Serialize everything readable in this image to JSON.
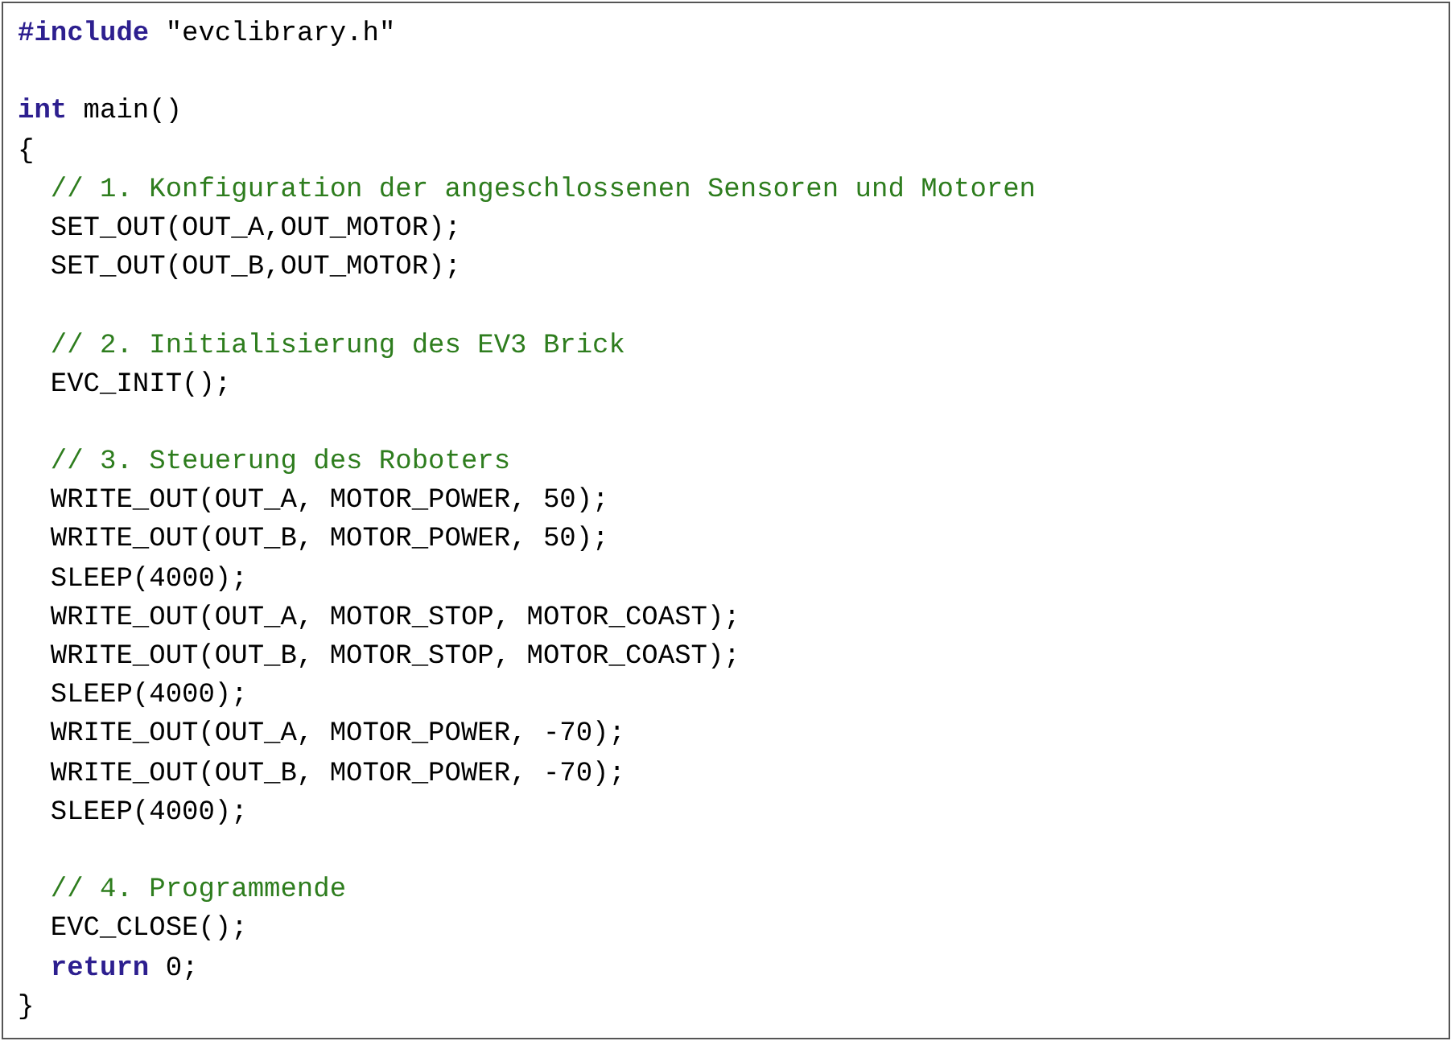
{
  "listing": {
    "lines": [
      {
        "kind": "code",
        "tokens": [
          {
            "kind": "keyword",
            "text": "#include"
          },
          {
            "kind": "plain",
            "text": " \"evclibrary.h\""
          }
        ]
      },
      {
        "kind": "blank"
      },
      {
        "kind": "code",
        "tokens": [
          {
            "kind": "keyword",
            "text": "int"
          },
          {
            "kind": "plain",
            "text": " main()"
          }
        ]
      },
      {
        "kind": "code",
        "tokens": [
          {
            "kind": "plain",
            "text": "{"
          }
        ]
      },
      {
        "kind": "code",
        "tokens": [
          {
            "kind": "comment",
            "text": "  // 1. Konfiguration der angeschlossenen Sensoren und Motoren"
          }
        ]
      },
      {
        "kind": "code",
        "tokens": [
          {
            "kind": "plain",
            "text": "  SET_OUT(OUT_A,OUT_MOTOR);"
          }
        ]
      },
      {
        "kind": "code",
        "tokens": [
          {
            "kind": "plain",
            "text": "  SET_OUT(OUT_B,OUT_MOTOR);"
          }
        ]
      },
      {
        "kind": "blank"
      },
      {
        "kind": "code",
        "tokens": [
          {
            "kind": "comment",
            "text": "  // 2. Initialisierung des EV3 Brick"
          }
        ]
      },
      {
        "kind": "code",
        "tokens": [
          {
            "kind": "plain",
            "text": "  EVC_INIT();"
          }
        ]
      },
      {
        "kind": "blank"
      },
      {
        "kind": "code",
        "tokens": [
          {
            "kind": "comment",
            "text": "  // 3. Steuerung des Roboters"
          }
        ]
      },
      {
        "kind": "code",
        "tokens": [
          {
            "kind": "plain",
            "text": "  WRITE_OUT(OUT_A, MOTOR_POWER, 50);"
          }
        ]
      },
      {
        "kind": "code",
        "tokens": [
          {
            "kind": "plain",
            "text": "  WRITE_OUT(OUT_B, MOTOR_POWER, 50);"
          }
        ]
      },
      {
        "kind": "code",
        "tokens": [
          {
            "kind": "plain",
            "text": "  SLEEP(4000);"
          }
        ]
      },
      {
        "kind": "code",
        "tokens": [
          {
            "kind": "plain",
            "text": "  WRITE_OUT(OUT_A, MOTOR_STOP, MOTOR_COAST);"
          }
        ]
      },
      {
        "kind": "code",
        "tokens": [
          {
            "kind": "plain",
            "text": "  WRITE_OUT(OUT_B, MOTOR_STOP, MOTOR_COAST);"
          }
        ]
      },
      {
        "kind": "code",
        "tokens": [
          {
            "kind": "plain",
            "text": "  SLEEP(4000);"
          }
        ]
      },
      {
        "kind": "code",
        "tokens": [
          {
            "kind": "plain",
            "text": "  WRITE_OUT(OUT_A, MOTOR_POWER, -70);"
          }
        ]
      },
      {
        "kind": "code",
        "tokens": [
          {
            "kind": "plain",
            "text": "  WRITE_OUT(OUT_B, MOTOR_POWER, -70);"
          }
        ]
      },
      {
        "kind": "code",
        "tokens": [
          {
            "kind": "plain",
            "text": "  SLEEP(4000);"
          }
        ]
      },
      {
        "kind": "blank"
      },
      {
        "kind": "code",
        "tokens": [
          {
            "kind": "comment",
            "text": "  // 4. Programmende"
          }
        ]
      },
      {
        "kind": "code",
        "tokens": [
          {
            "kind": "plain",
            "text": "  EVC_CLOSE();"
          }
        ]
      },
      {
        "kind": "code",
        "tokens": [
          {
            "kind": "keyword",
            "text": "  return"
          },
          {
            "kind": "plain",
            "text": " 0;"
          }
        ]
      },
      {
        "kind": "code",
        "tokens": [
          {
            "kind": "plain",
            "text": "}"
          }
        ]
      }
    ]
  }
}
